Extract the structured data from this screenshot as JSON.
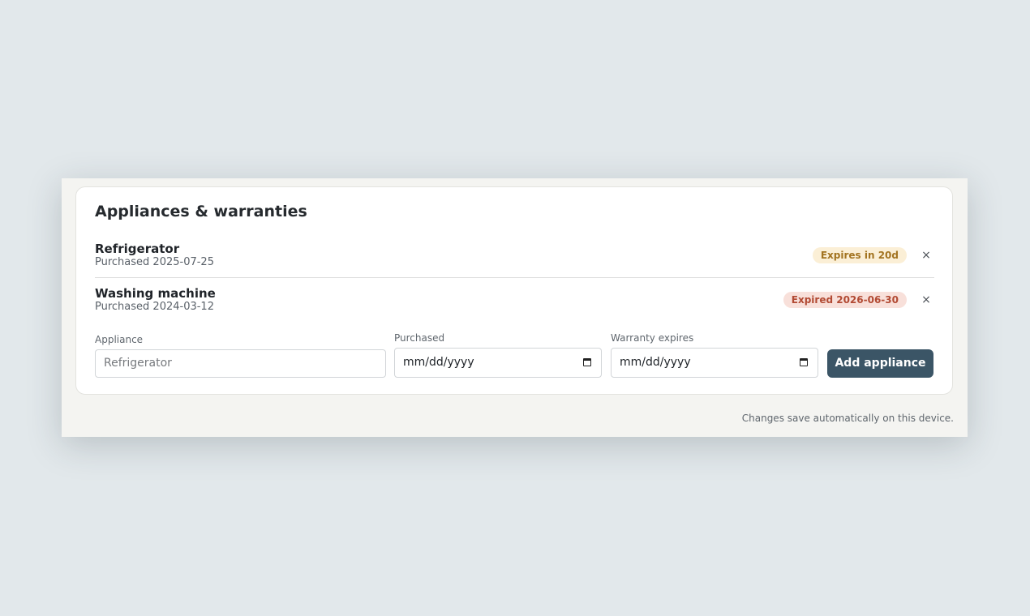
{
  "card": {
    "title": "Appliances & warranties"
  },
  "appliances": [
    {
      "name": "Refrigerator",
      "purchased": "Purchased 2025-07-25",
      "status": "Expires in 20d",
      "status_kind": "warning",
      "remove_label": "×"
    },
    {
      "name": "Washing machine",
      "purchased": "Purchased 2024-03-12",
      "status": "Expired 2026-06-30",
      "status_kind": "expired",
      "remove_label": "×"
    }
  ],
  "form": {
    "appliance_label": "Appliance",
    "appliance_placeholder": "Refrigerator",
    "purchased_label": "Purchased",
    "purchased_value": "mm/dd/yyyy",
    "warranty_label": "Warranty expires",
    "warranty_value": "mm/dd/yyyy",
    "submit_label": "Add appliance"
  },
  "footer": {
    "note": "Changes save automatically on this device."
  },
  "colors": {
    "accent": "#3b5566",
    "warning_bg": "#fbefd6",
    "warning_text": "#a37421",
    "expired_bg": "#f8e0da",
    "expired_text": "#b24a33"
  },
  "icons": {
    "remove": "close-icon",
    "calendar": "calendar-icon"
  }
}
